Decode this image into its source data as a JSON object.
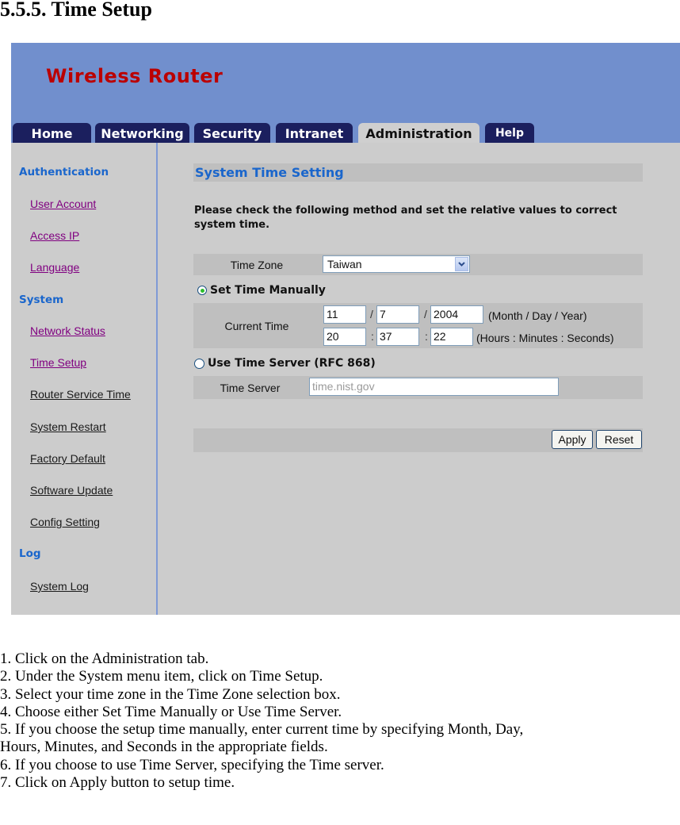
{
  "document": {
    "heading": "5.5.5. Time Setup",
    "steps": [
      "1. Click on the Administration tab.",
      "2. Under the System menu item, click on Time Setup.",
      "3. Select your time zone in the Time Zone selection box.",
      "4. Choose either Set Time Manually or Use Time Server.",
      "5. If you choose the setup time manually, enter current time by specifying Month, Day,",
      "Hours, Minutes, and Seconds in the appropriate fields.",
      "6. If you choose to use Time Server, specifying the Time server.",
      "7. Click on Apply button to setup time."
    ]
  },
  "router": {
    "brand": "Wireless Router",
    "colors": {
      "banner": "#718fcd",
      "brand": "#bb0000",
      "tab": "#1b1f5e",
      "accent": "#1a66cc",
      "panel": "#cccccc"
    },
    "tabs": [
      {
        "label": "Home",
        "active": false
      },
      {
        "label": "Networking",
        "active": false
      },
      {
        "label": "Security",
        "active": false
      },
      {
        "label": "Intranet",
        "active": false
      },
      {
        "label": "Administration",
        "active": true
      },
      {
        "label": "Help",
        "active": false
      }
    ],
    "sidebar": {
      "sections": [
        {
          "title": "Authentication",
          "items": [
            "User Account",
            "Access IP",
            "Language"
          ]
        },
        {
          "title": "System",
          "items": [
            "Network Status",
            "Time Setup",
            "Router Service Time",
            "System Restart",
            "Factory Default",
            "Software Update",
            "Config Setting"
          ]
        },
        {
          "title": "Log",
          "items": [
            "System Log"
          ]
        }
      ]
    },
    "main": {
      "title": "System Time Setting",
      "description": "Please check the following method and set the relative values to correct system time.",
      "time_zone": {
        "label": "Time Zone",
        "value": "Taiwan",
        "icon": "chevron-down-icon"
      },
      "manual": {
        "label": "Set Time Manually",
        "selected": true,
        "current_time_label": "Current Time",
        "month": "11",
        "day": "7",
        "year": "2004",
        "hours": "20",
        "minutes": "37",
        "seconds": "22",
        "date_sep": "/",
        "time_sep": ":",
        "date_hint": "(Month / Day / Year)",
        "time_hint": "(Hours : Minutes : Seconds)"
      },
      "server": {
        "label": "Use Time Server (RFC 868)",
        "selected": false,
        "field_label": "Time Server",
        "value": "time.nist.gov"
      },
      "buttons": {
        "apply": "Apply",
        "reset": "Reset"
      }
    }
  }
}
